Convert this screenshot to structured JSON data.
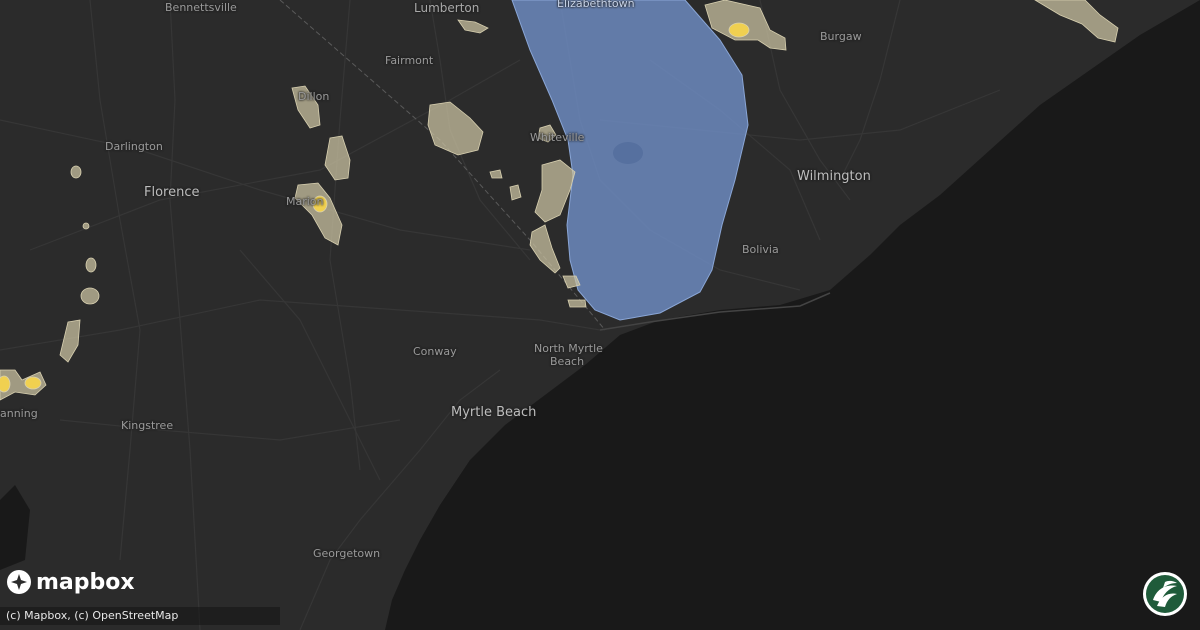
{
  "map": {
    "colors": {
      "land": "#2b2b2b",
      "ocean": "#191919",
      "road": "#3a3a3a",
      "alert_fill": "#6f8ec4",
      "storm_low": "#c8c0a0",
      "storm_high": "#f0d050"
    },
    "places": [
      {
        "id": "bennettsville",
        "name": "Bennettsville",
        "size": "small"
      },
      {
        "id": "lumberton",
        "name": "Lumberton",
        "size": "mid"
      },
      {
        "id": "elizabethtown",
        "name": "Elizabethtown",
        "size": "small"
      },
      {
        "id": "burgaw",
        "name": "Burgaw",
        "size": "small"
      },
      {
        "id": "fairmont",
        "name": "Fairmont",
        "size": "small"
      },
      {
        "id": "dillon",
        "name": "Dillon",
        "size": "small"
      },
      {
        "id": "darlington",
        "name": "Darlington",
        "size": "small"
      },
      {
        "id": "whiteville",
        "name": "Whiteville",
        "size": "small"
      },
      {
        "id": "florence",
        "name": "Florence",
        "size": "mid"
      },
      {
        "id": "marion",
        "name": "Marion",
        "size": "small"
      },
      {
        "id": "wilmington",
        "name": "Wilmington",
        "size": "mid"
      },
      {
        "id": "bolivia",
        "name": "Bolivia",
        "size": "small"
      },
      {
        "id": "north_myrtle_beach_1",
        "name": "North Myrtle",
        "size": "small"
      },
      {
        "id": "north_myrtle_beach_2",
        "name": "Beach",
        "size": "small"
      },
      {
        "id": "conway",
        "name": "Conway",
        "size": "small"
      },
      {
        "id": "myrtle_beach",
        "name": "Myrtle Beach",
        "size": "mid"
      },
      {
        "id": "kingstree",
        "name": "Kingstree",
        "size": "small"
      },
      {
        "id": "manning",
        "name": "anning",
        "size": "small"
      },
      {
        "id": "georgetown",
        "name": "Georgetown",
        "size": "small"
      }
    ]
  },
  "branding": {
    "logo_text": "mapbox",
    "attribution": "(c) Mapbox, (c) OpenStreetMap",
    "logo_icon": "mapbox-icon",
    "brand_icon": "storm-brand-icon"
  }
}
